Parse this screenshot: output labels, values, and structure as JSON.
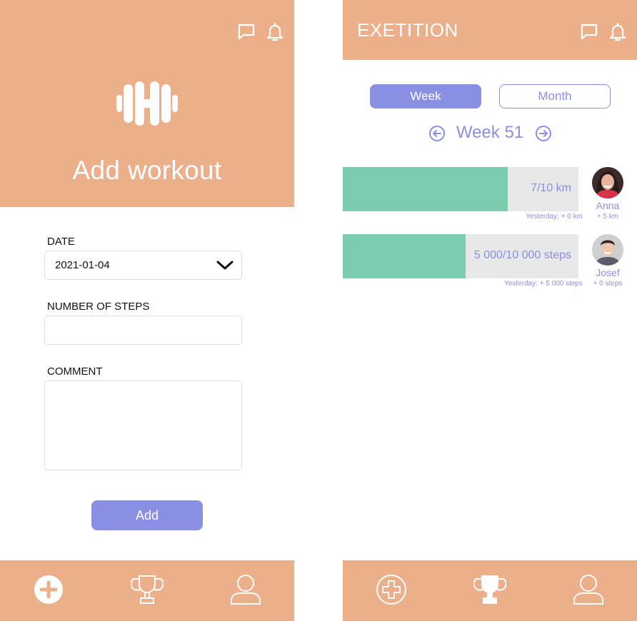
{
  "colors": {
    "peach": "#ebaf8a",
    "accent": "#8a8fe2",
    "progress_fill": "#7ccdae",
    "progress_track": "#e8e8e8",
    "white": "#ffffff"
  },
  "left_screen": {
    "header": {
      "icons": [
        "message-icon",
        "bell-icon"
      ],
      "hero_icon": "dumbbell-icon",
      "title": "Add workout"
    },
    "form": {
      "date": {
        "label": "DATE",
        "value": "2021-01-04"
      },
      "steps": {
        "label": "NUMBER OF STEPS",
        "value": ""
      },
      "comment": {
        "label": "COMMENT",
        "value": ""
      },
      "submit_label": "Add"
    },
    "bottom_nav": {
      "items": [
        {
          "icon": "plus-circle-icon",
          "active": true
        },
        {
          "icon": "trophy-icon",
          "active": false
        },
        {
          "icon": "user-icon",
          "active": false
        }
      ]
    }
  },
  "right_screen": {
    "header": {
      "title": "EXETITION",
      "icons": [
        "message-icon",
        "bell-icon"
      ]
    },
    "tabs": [
      {
        "label": "Week",
        "selected": true
      },
      {
        "label": "Month",
        "selected": false
      }
    ],
    "period": {
      "label": "Week 51",
      "prev_icon": "arrow-left-circle-icon",
      "next_icon": "arrow-right-circle-icon"
    },
    "participants": [
      {
        "name": "Anna",
        "progress_text": "7/10 km",
        "progress_fraction": 0.7,
        "yesterday": "Yesterday: + 0 km",
        "delta": "+ 5 km",
        "avatar": "avatar-anna"
      },
      {
        "name": "Josef",
        "progress_text": "5 000/10 000 steps",
        "progress_fraction": 0.52,
        "yesterday": "Yesterday: + 5 000 steps",
        "delta": "+ 0 steps",
        "avatar": "avatar-josef"
      }
    ],
    "bottom_nav": {
      "items": [
        {
          "icon": "plus-circle-icon",
          "active": false
        },
        {
          "icon": "trophy-icon",
          "active": true
        },
        {
          "icon": "user-icon",
          "active": false
        }
      ]
    }
  }
}
